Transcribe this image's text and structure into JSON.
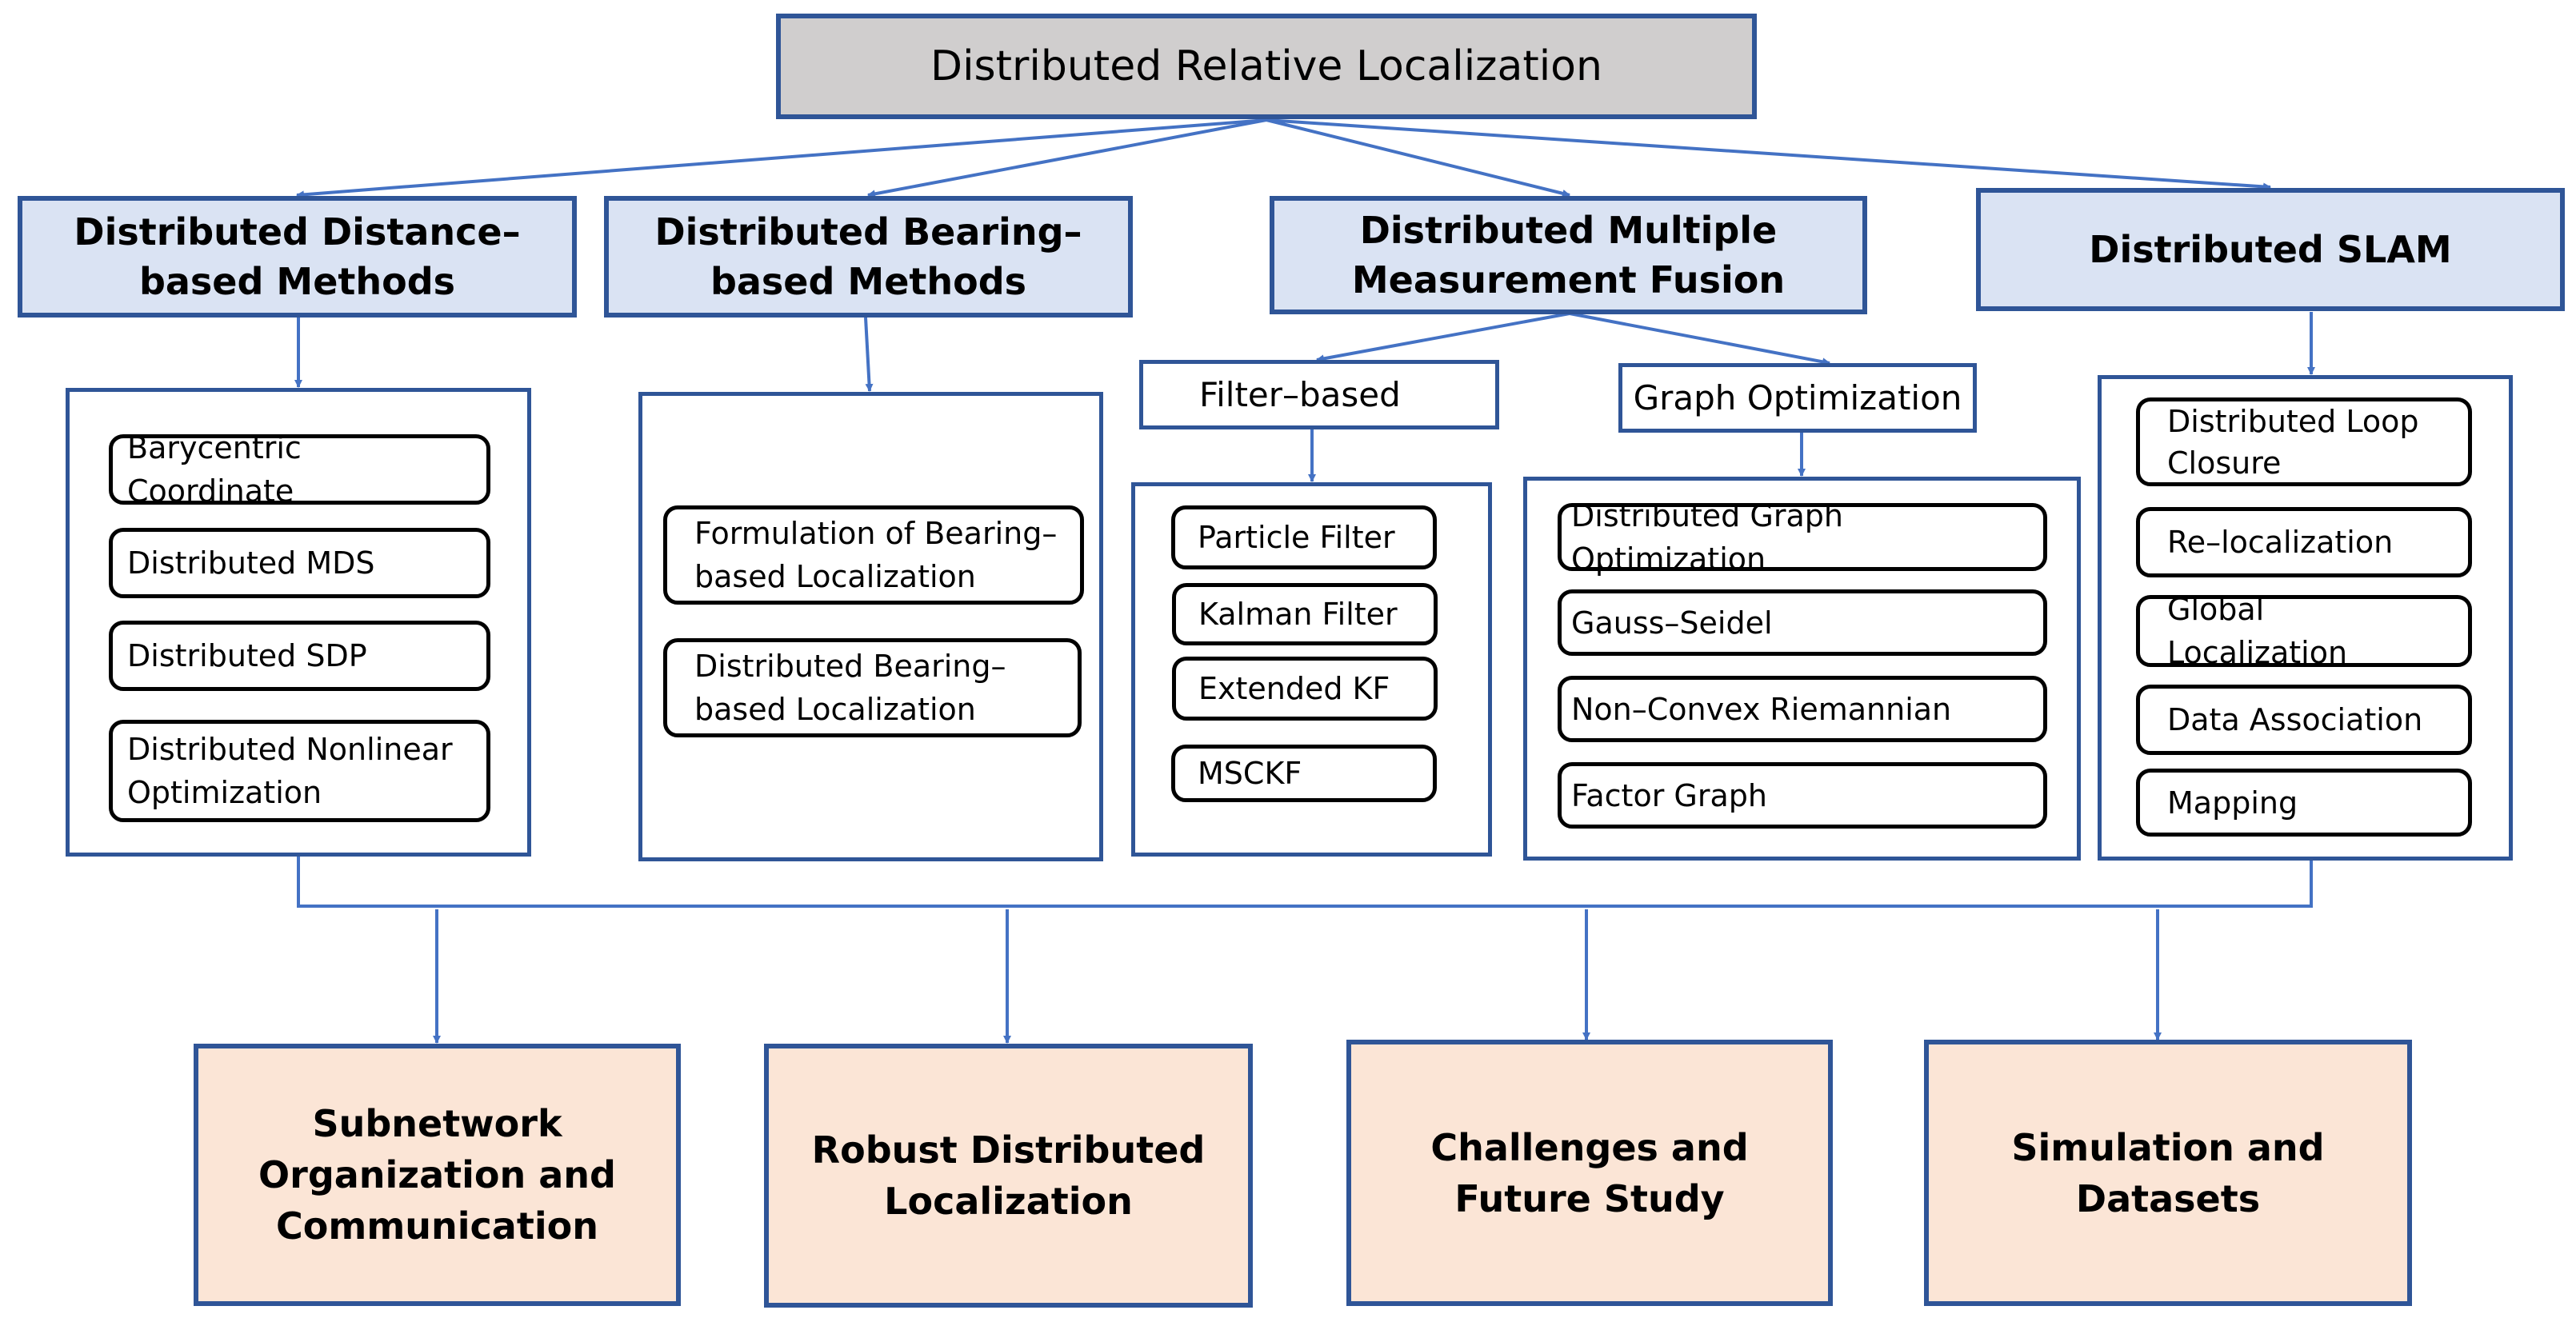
{
  "root": {
    "label": "Distributed Relative Localization"
  },
  "categories": [
    {
      "label": "Distributed Distance–based Methods"
    },
    {
      "label": "Distributed Bearing–based Methods"
    },
    {
      "label": "Distributed Multiple Measurement Fusion"
    },
    {
      "label": "Distributed SLAM"
    }
  ],
  "fusion_branches": [
    {
      "label": "Filter–based"
    },
    {
      "label": "Graph Optimization"
    }
  ],
  "distance_methods": [
    "Barycentric Coordinate",
    "Distributed MDS",
    "Distributed SDP",
    "Distributed Nonlinear Optimization"
  ],
  "bearing_methods": [
    "Formulation of Bearing–based Localization",
    "Distributed Bearing–based Localization"
  ],
  "filter_methods": [
    "Particle Filter",
    "Kalman Filter",
    "Extended KF",
    "MSCKF"
  ],
  "graph_methods": [
    "Distributed Graph Optimization",
    "Gauss–Seidel",
    "Non–Convex Riemannian",
    "Factor Graph"
  ],
  "slam_methods": [
    "Distributed Loop Closure",
    "Re–localization",
    "Global Localization",
    "Data Association",
    "Mapping"
  ],
  "outcomes": [
    {
      "label": "Subnetwork Organization and Communication"
    },
    {
      "label": "Robust Distributed Localization"
    },
    {
      "label": "Challenges and Future Study"
    },
    {
      "label": "Simulation and Datasets"
    }
  ],
  "colors": {
    "border": "#2f5597",
    "arrow": "#4472c4",
    "root_fill": "#d0cece",
    "category_fill": "#dae3f3",
    "outcome_fill": "#fbe5d6"
  }
}
